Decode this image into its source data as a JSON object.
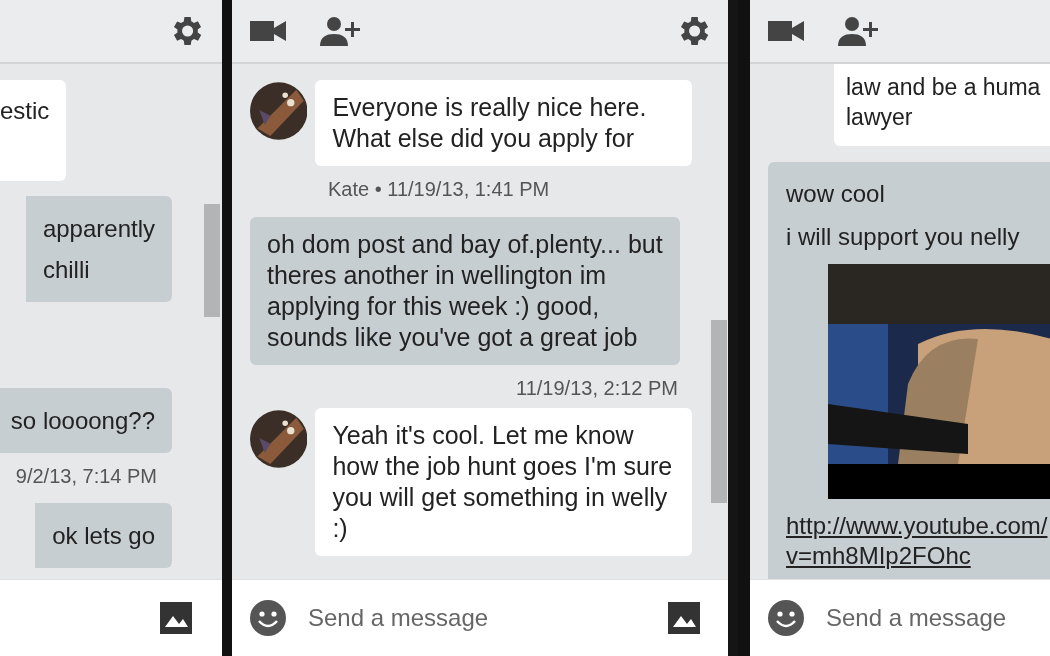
{
  "panels": [
    {
      "toolbar": {
        "call_buttons": false,
        "settings_button": true
      },
      "messages": [
        {
          "kind": "incoming",
          "avatar": false,
          "lines": [
            "estic"
          ]
        },
        {
          "kind": "outgoing",
          "lines": [
            "apparently",
            "chilli"
          ]
        },
        {
          "kind": "outgoing",
          "lines": [
            "so loooong??"
          ]
        },
        {
          "kind": "outgoing_meta",
          "text": "9/2/13, 7:14 PM"
        },
        {
          "kind": "outgoing",
          "lines": [
            "ok lets go"
          ]
        }
      ],
      "footer": {
        "emoji_button": false,
        "image_button": true
      }
    },
    {
      "toolbar": {
        "call_buttons": true,
        "settings_button": true
      },
      "messages": [
        {
          "kind": "incoming",
          "avatar": true,
          "text": "Everyone is really nice here. What else did you apply for"
        },
        {
          "kind": "incoming_meta",
          "text": "Kate • 11/19/13, 1:41 PM"
        },
        {
          "kind": "outgoing",
          "text": "oh dom post and bay of.plenty... but theres another in wellington im applying for this week :) good, sounds like you've got a great job"
        },
        {
          "kind": "outgoing_meta",
          "text": "11/19/13, 2:12 PM"
        },
        {
          "kind": "incoming",
          "avatar": true,
          "text": "Yeah it's cool. Let me know how the job hunt goes I'm sure you will get something in welly :)"
        }
      ],
      "footer": {
        "emoji_button": true,
        "placeholder": "Send a message",
        "image_button": true
      }
    },
    {
      "toolbar": {
        "call_buttons": true,
        "settings_button": false
      },
      "messages": [
        {
          "kind": "incoming",
          "avatar": false,
          "lines": [
            "law and be a huma",
            "lawyer"
          ]
        },
        {
          "kind": "outgoing",
          "lines": [
            "wow cool",
            "i will support you nelly"
          ],
          "attachment": {
            "kind": "picture"
          },
          "link_lines": [
            "http://www.youtube.com/",
            "v=mh8MIp2FOhc"
          ]
        }
      ],
      "footer": {
        "emoji_button": true,
        "placeholder": "Send a message",
        "image_button": false
      }
    }
  ]
}
